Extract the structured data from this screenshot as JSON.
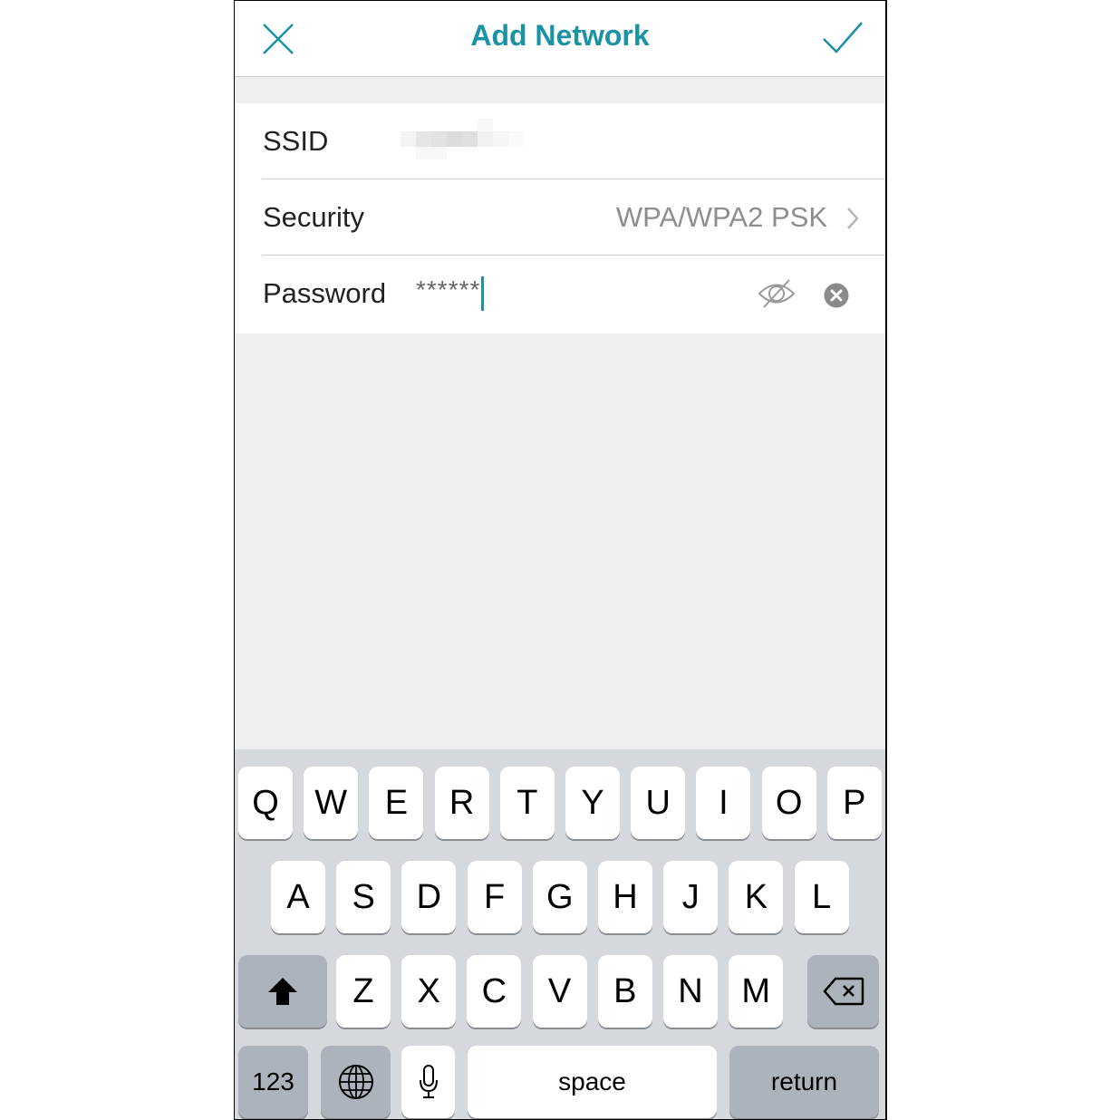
{
  "navbar": {
    "title": "Add Network",
    "close_icon": "close-icon",
    "confirm_icon": "checkmark-icon",
    "accent_color": "#1a93a4"
  },
  "form": {
    "ssid": {
      "label": "SSID",
      "value_obscured": true
    },
    "security": {
      "label": "Security",
      "value": "WPA/WPA2 PSK"
    },
    "password": {
      "label": "Password",
      "value": "******",
      "toggle_icon": "eye-slash-icon",
      "clear_icon": "clear-circle-icon"
    }
  },
  "keyboard": {
    "row1": [
      "Q",
      "W",
      "E",
      "R",
      "T",
      "Y",
      "U",
      "I",
      "O",
      "P"
    ],
    "row2": [
      "A",
      "S",
      "D",
      "F",
      "G",
      "H",
      "J",
      "K",
      "L"
    ],
    "row3": [
      "Z",
      "X",
      "C",
      "V",
      "B",
      "N",
      "M"
    ],
    "numbers_label": "123",
    "space_label": "space",
    "return_label": "return"
  }
}
